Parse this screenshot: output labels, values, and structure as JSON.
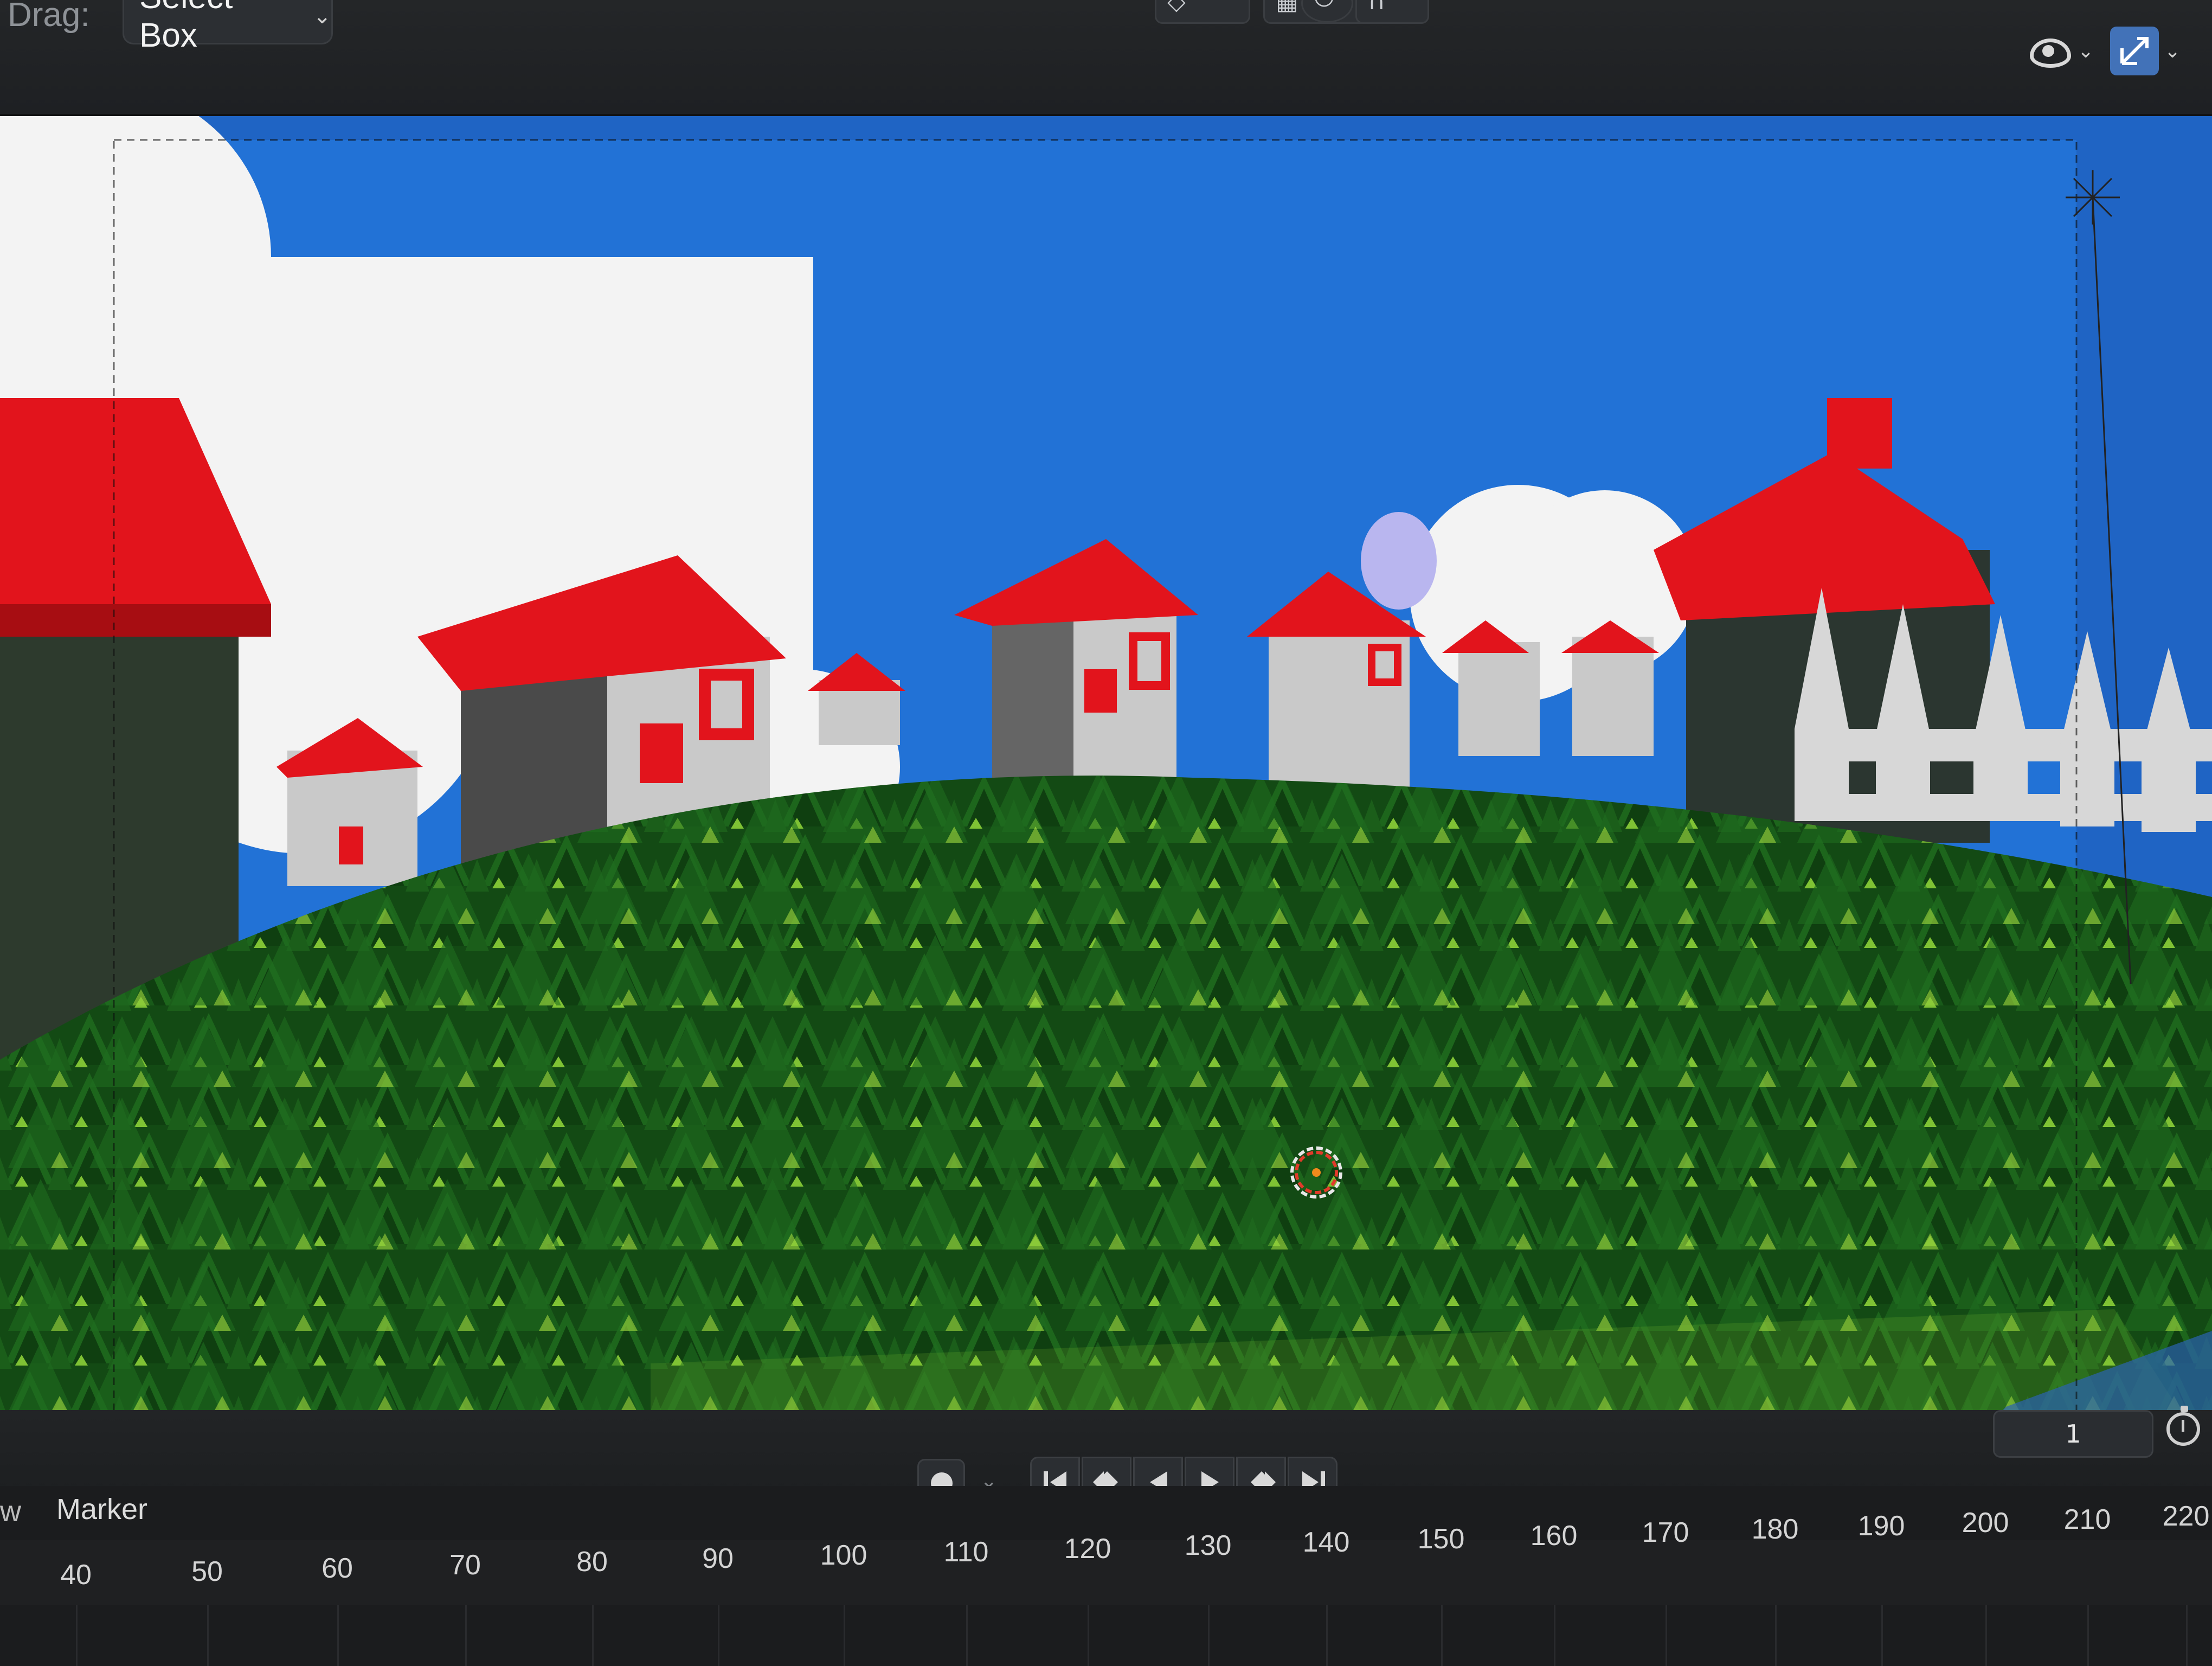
{
  "header": {
    "drag_label": "Drag:",
    "select_mode": "Select Box"
  },
  "viewport": {
    "icons": [
      "eye-icon",
      "gizmo-icon",
      "3d-cursor-icon"
    ],
    "colors": {
      "sky": "#1f64c4",
      "grass_dark": "#144d14",
      "grass_light": "#7fc234",
      "roof": "#e2141c",
      "walls": "#c9c9c9",
      "clouds": "#f3f3f3"
    }
  },
  "playback": {
    "current_frame": "1",
    "buttons": [
      "jump-start",
      "prev-keyframe",
      "play-reverse",
      "play",
      "next-keyframe",
      "jump-end"
    ]
  },
  "timeline": {
    "view_fragment": "w",
    "marker_menu": "Marker",
    "ticks": [
      "40",
      "50",
      "60",
      "70",
      "80",
      "90",
      "100",
      "110",
      "120",
      "130",
      "140",
      "150",
      "160",
      "170",
      "180",
      "190",
      "200",
      "210",
      "220"
    ]
  }
}
